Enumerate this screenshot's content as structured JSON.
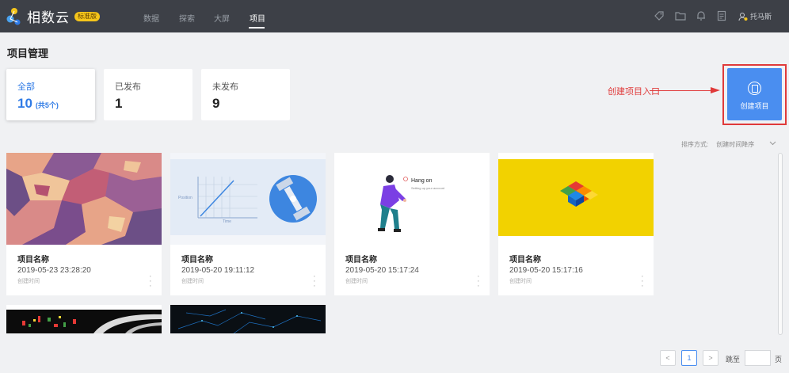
{
  "app": {
    "name": "相数云",
    "badge": "标准版",
    "nav": [
      {
        "label": "数据"
      },
      {
        "label": "探索"
      },
      {
        "label": "大屏"
      },
      {
        "label": "项目"
      }
    ],
    "user": "托马斯"
  },
  "page": {
    "title": "项目管理",
    "stats": [
      {
        "label": "全部",
        "value": "10",
        "sub": "(共5个)"
      },
      {
        "label": "已发布",
        "value": "1"
      },
      {
        "label": "未发布",
        "value": "9"
      }
    ],
    "create": {
      "annotation": "创建项目入口",
      "label": "创建项目"
    },
    "sort": {
      "label": "排序方式:",
      "value": "创建时间降序"
    }
  },
  "projects": [
    {
      "title": "项目名称",
      "date": "2019-05-23 23:28:20",
      "caption": "创建时间"
    },
    {
      "title": "项目名称",
      "date": "2019-05-20 19:11:12",
      "caption": "创建时间"
    },
    {
      "title": "项目名称",
      "date": "2019-05-20 15:17:24",
      "caption": "创建时间"
    },
    {
      "title": "项目名称",
      "date": "2019-05-20 15:17:16",
      "caption": "创建时间"
    }
  ],
  "thumbs": {
    "chart_axis_y": "Position",
    "chart_axis_x": "Time",
    "hang_on_title": "Hang on",
    "hang_on_sub": "Setting up your account"
  },
  "pagination": {
    "prev": "<",
    "current": "1",
    "next": ">",
    "jump": "跳至",
    "unit": "页"
  },
  "colors": {
    "topbar": "#3d4047",
    "accent": "#4a8ef0",
    "annotation": "#e03a3a",
    "badge": "#f5c51b"
  }
}
